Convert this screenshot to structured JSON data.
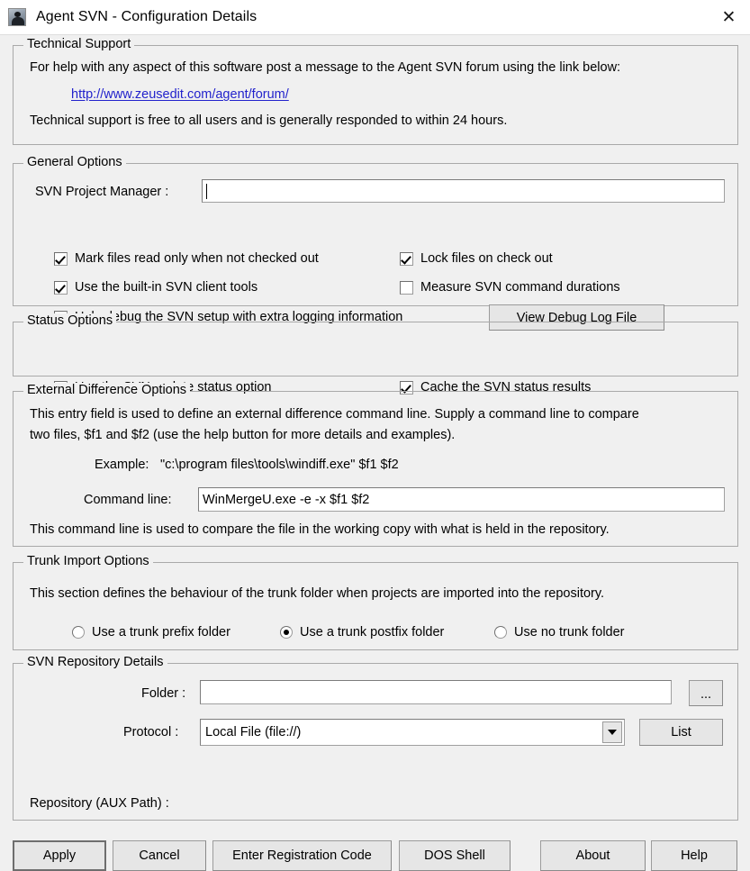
{
  "window": {
    "title": "Agent SVN - Configuration Details",
    "app_icon": "agent-app-icon",
    "close_label": "✕"
  },
  "technical_support": {
    "legend": "Technical Support",
    "line1": "For help with any aspect of this software post a message to the Agent SVN forum using the link below:",
    "link": "http://www.zeusedit.com/agent/forum/",
    "line2": "Technical support is free to all users and is generally responded to within 24 hours."
  },
  "general_options": {
    "legend": "General Options",
    "project_manager_label": "SVN Project Manager :",
    "project_manager_value": "",
    "checkboxes": [
      {
        "label": "Mark files read only when not checked out",
        "checked": true
      },
      {
        "label": "Lock files on check out",
        "checked": true
      },
      {
        "label": "Use the built-in SVN client tools",
        "checked": true
      },
      {
        "label": "Measure SVN command durations",
        "checked": false
      },
      {
        "label": "Help debug the SVN setup with extra logging information",
        "checked": false
      }
    ],
    "view_debug_log_label": "View Debug Log File"
  },
  "status_options": {
    "legend": "Status Options",
    "checkboxes": [
      {
        "label": "Use the SVN update status option",
        "checked": true
      },
      {
        "label": "Cache the SVN status results",
        "checked": true
      }
    ]
  },
  "external_difference_options": {
    "legend": "External Difference Options",
    "desc_line1": "This entry field is used to define an external difference command line. Supply a command line to compare",
    "desc_line2": "two files, $f1 and $f2 (use the help button for more details and examples).",
    "example_label": "Example:",
    "example_value": "\"c:\\program files\\tools\\windiff.exe\" $f1 $f2",
    "command_line_label": "Command line:",
    "command_line_value": "WinMergeU.exe -e -x $f1 $f2",
    "footer": "This command line is used to compare the file in the working copy with what is held in the repository."
  },
  "trunk_import_options": {
    "legend": "Trunk Import Options",
    "desc": "This section defines the behaviour of the trunk folder when projects are imported into the repository.",
    "radios": [
      {
        "label": "Use a trunk prefix folder",
        "selected": false
      },
      {
        "label": "Use a trunk postfix folder",
        "selected": true
      },
      {
        "label": "Use no trunk folder",
        "selected": false
      }
    ]
  },
  "svn_repository_details": {
    "legend": "SVN Repository Details",
    "folder_label": "Folder :",
    "folder_value": "",
    "browse_label": "...",
    "protocol_label": "Protocol :",
    "protocol_value": "Local File (file://)",
    "list_label": "List",
    "aux_path_label": "Repository (AUX Path) :"
  },
  "footer_buttons": [
    {
      "label": "Apply",
      "default": true
    },
    {
      "label": "Cancel",
      "default": false
    },
    {
      "label": "Enter Registration Code",
      "default": false
    },
    {
      "label": "DOS Shell",
      "default": false
    },
    {
      "label": "About",
      "default": false
    },
    {
      "label": "Help",
      "default": false
    }
  ]
}
